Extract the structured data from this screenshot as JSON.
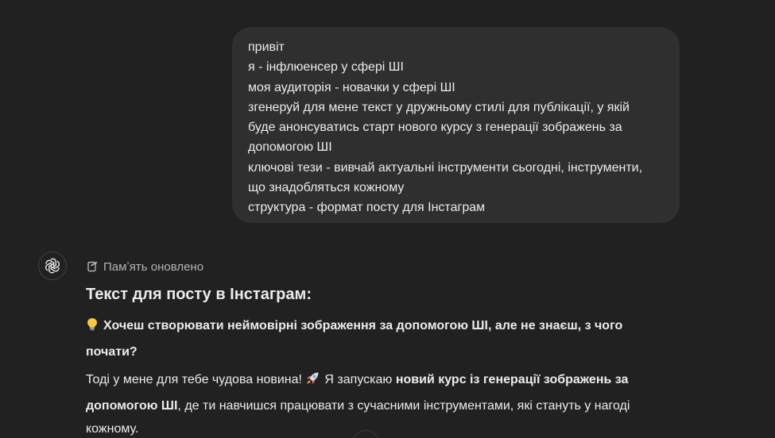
{
  "user_message": {
    "lines": [
      "привіт",
      "я - інфлюенсер у сфері ШІ",
      "моя аудиторія - новачки у сфері ШІ",
      "згенеруй для мене текст у дружньому стилі для публікації, у якій",
      "буде анонсуватись старт нового курсу з генерації зображень за",
      "допомогою ШІ",
      "ключові тези - вивчай актуальні інструменти сьогодні, інструменти,",
      "що знадобляться кожному",
      "структура - формат посту для Інстаграм"
    ]
  },
  "assistant": {
    "avatar_icon": "openai-logo-icon",
    "memory_label": "Памʼять оновлено",
    "memory_icon": "memory-edit-icon",
    "heading": "Текст для посту в Інстаграм:",
    "para1": {
      "emoji": "💡",
      "bold_text_line1": "Хочеш створювати неймовірні зображення за допомогою ШІ, але не знаєш, з чого",
      "bold_text_line2": "почати?"
    },
    "para2": {
      "text_before": "Тоді у мене для тебе чудова новина!",
      "emoji": "🚀",
      "text_mid": "Я запускаю",
      "bold_line1": "новий курс із генерації зображень за",
      "bold_line2": "допомогою ШІ",
      "text_after_line2": ", де ти навчишся працювати з сучасними інструментами, які стануть у нагоді",
      "text_line3": "кожному."
    }
  },
  "colors": {
    "background": "#212121",
    "user_bubble": "#2f2f2f",
    "text": "#ececec",
    "muted": "#b4b4b4",
    "rocket": "#e0566c"
  }
}
